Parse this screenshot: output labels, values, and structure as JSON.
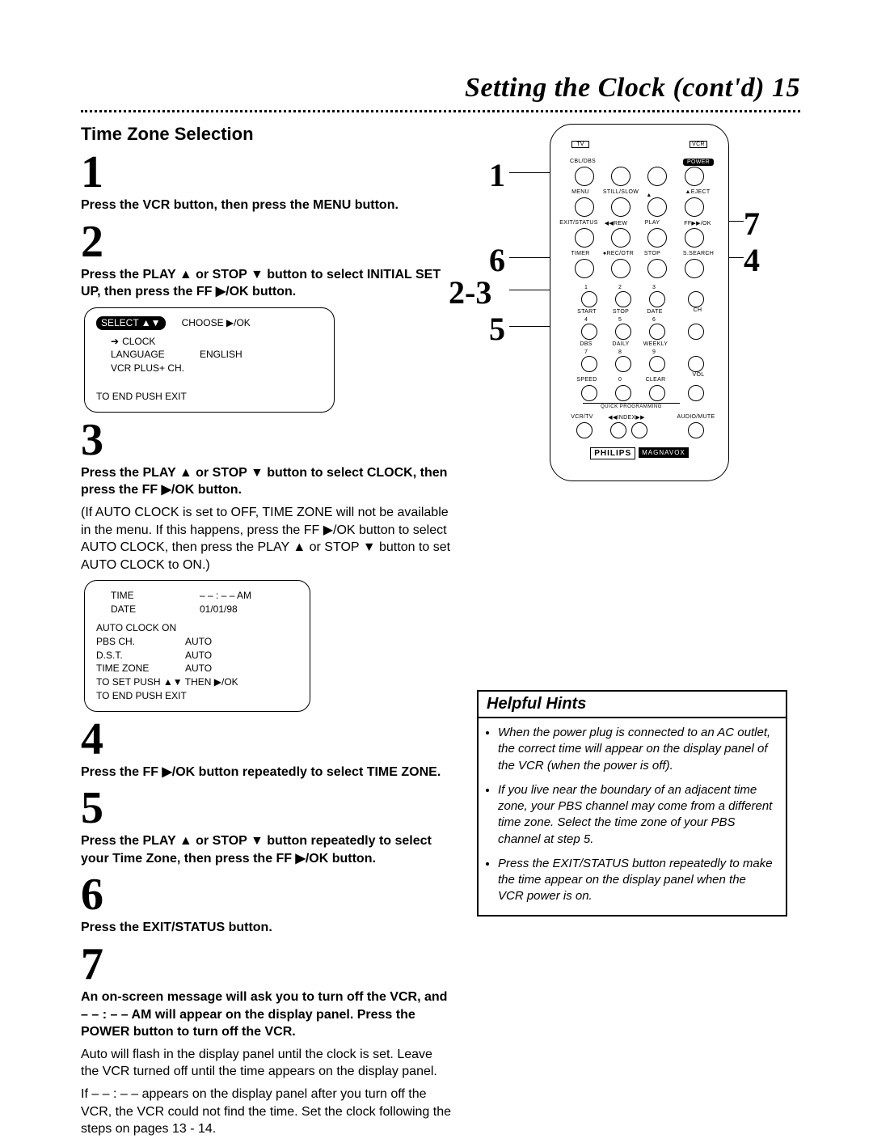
{
  "header": {
    "title": "Setting the Clock (cont'd)  15"
  },
  "section": {
    "title": "Time Zone Selection"
  },
  "steps": {
    "s1": {
      "num": "1",
      "body": "Press the VCR button, then press the MENU button."
    },
    "s2": {
      "num": "2",
      "body": "Press the PLAY ▲ or STOP ▼ button to select INITIAL SET UP, then press the FF ▶/OK button."
    },
    "s3": {
      "num": "3",
      "body": "Press the PLAY ▲ or STOP ▼ button to select CLOCK, then press the FF ▶/OK button.",
      "note": "(If AUTO CLOCK is set to OFF, TIME ZONE will not be available in the menu. If this happens, press the FF ▶/OK button to select AUTO CLOCK, then press the PLAY ▲ or STOP ▼ button to set AUTO CLOCK to ON.)"
    },
    "s4": {
      "num": "4",
      "body": "Press the FF ▶/OK button repeatedly to select TIME ZONE."
    },
    "s5": {
      "num": "5",
      "body": "Press the PLAY ▲ or STOP ▼ button repeatedly to select your Time Zone, then press the FF ▶/OK button."
    },
    "s6": {
      "num": "6",
      "body": "Press the EXIT/STATUS button."
    },
    "s7": {
      "num": "7",
      "body": "An on-screen message will ask you to turn off the VCR, and – – : – – AM will appear on the display panel. Press the POWER button to turn off the VCR.",
      "note1": "Auto will flash in the display panel until the clock is set. Leave the VCR turned off until the time appears on the display panel.",
      "note2": "If – – : – – appears on the display panel after you turn off the VCR, the VCR could not find the time. Set the clock following the steps on pages 13 - 14."
    }
  },
  "osd1": {
    "header_left": "SELECT ▲▼",
    "header_right": "CHOOSE ▶/OK",
    "clock": "CLOCK",
    "language_label": "LANGUAGE",
    "language_value": "ENGLISH",
    "vcrplus": "VCR PLUS+ CH.",
    "footer": "TO END PUSH EXIT"
  },
  "osd2": {
    "time_label": "TIME",
    "time_value": "– – : – – AM",
    "date_label": "DATE",
    "date_value": "01/01/98",
    "auto_clock": "AUTO CLOCK ON",
    "pbs_label": "PBS CH.",
    "pbs_value": "AUTO",
    "dst_label": "D.S.T.",
    "dst_value": "AUTO",
    "tz_label": "TIME ZONE",
    "tz_value": "AUTO",
    "set_line": "TO SET PUSH ▲▼ THEN ▶/OK",
    "end_line": "TO END PUSH EXIT"
  },
  "remote": {
    "labels": {
      "tv": "TV",
      "vcr": "VCR",
      "cbl": "CBL/DBS",
      "power": "POWER",
      "menu": "MENU",
      "stillslow": "STILL/SLOW",
      "eject": "▲EJECT",
      "exit": "EXIT/STATUS",
      "rew": "◀◀REW",
      "play": "PLAY",
      "ffok": "FF▶▶/OK",
      "timer": "TIMER",
      "recotr": "●REC/OTR",
      "stop": "STOP",
      "ssearch": "S.SEARCH",
      "n1": "1",
      "n2": "2",
      "n3": "3",
      "n4": "4",
      "n5": "5",
      "n6": "6",
      "n7": "7",
      "n8": "8",
      "n9": "9",
      "n0": "0",
      "start": "START",
      "stopL": "STOP",
      "date": "DATE",
      "ch": "CH",
      "dbs": "DBS",
      "daily": "DAILY",
      "weekly": "WEEKLY",
      "vol": "VOL",
      "speed": "SPEED",
      "clear": "CLEAR",
      "vcrtv": "VCR/TV",
      "index": "◀◀INDEX▶▶",
      "audiomute": "AUDIO/MUTE",
      "qp": "QUICK PROGRAMMING"
    },
    "brand_philips": "PHILIPS",
    "brand_magnavox": "MAGNAVOX"
  },
  "callouts": {
    "c1": "1",
    "c23": "2-3",
    "c4": "4",
    "c5": "5",
    "c6": "6",
    "c7": "7"
  },
  "hints": {
    "title": "Helpful Hints",
    "items": [
      "When the power plug is connected to an AC outlet, the correct time will appear on the display panel of the VCR (when the power is off).",
      "If you live near the boundary of an adjacent time zone, your PBS channel may come from a different time zone. Select the time zone of your PBS channel at step 5.",
      "Press the EXIT/STATUS button repeatedly to make the time appear on the display panel when the VCR power is on."
    ]
  }
}
